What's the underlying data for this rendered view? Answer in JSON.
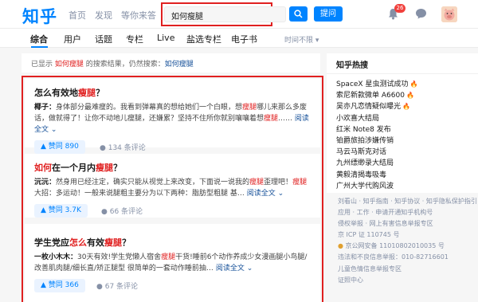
{
  "header": {
    "logo": "知乎",
    "nav": [
      "首页",
      "发现",
      "等你来答"
    ],
    "search_value": "如何瘦腿",
    "ask_label": "提问",
    "notification_count": "26"
  },
  "tabs": {
    "items": [
      "综合",
      "用户",
      "话题",
      "专栏",
      "Live",
      "盐选专栏",
      "电子书"
    ],
    "time_filter": "时间不限"
  },
  "notice": {
    "prefix": "已显示 ",
    "keyword": "如何瘦腿",
    "middle": " 的搜索结果，仍然搜索：",
    "link": "如何瘦腿"
  },
  "results": [
    {
      "title_pre": "怎么有效地",
      "title_kw": "瘦腿",
      "title_post": "？",
      "author": "椰子：",
      "excerpt_a": "身体部分最难瘦的。我看到弹幕真的想给她们一个白眼，想",
      "excerpt_kw": "瘦腿",
      "excerpt_b": "哪儿来那么多废话，做就得了！让你不动地儿瘦腿，还嫌累？坚持不住所你就别嚷嚷着想",
      "excerpt_kw2": "瘦腿",
      "excerpt_c": "……",
      "more": "阅读全文",
      "votes": "赞同 890",
      "comments": "134 条评论"
    },
    {
      "title_pre": "",
      "title_kw": "如何",
      "title_post": "在一个月内",
      "title_kw2": "瘦腿",
      "title_end": "？",
      "author": "沅沅：",
      "excerpt_a": "然身用已经注定，确实只能从视觉上来改变，下面说一说我的",
      "excerpt_kw": "瘦腿",
      "excerpt_b": "歪理吧！",
      "excerpt_kw2": "瘦腿",
      "excerpt_c": "大招：多运动！一般来说腿粗主要分为以下两种：脂肪型粗腿 基…",
      "more": "阅读全文",
      "votes": "赞同 3.7K",
      "comments": "66 条评论"
    },
    {
      "title_pre": "学生党应",
      "title_kw": "怎么",
      "title_post": "有效",
      "title_kw2": "瘦腿",
      "title_end": "？",
      "author": "一枚小木木：",
      "excerpt_a": "30天有效!学生党懒人宿舍",
      "excerpt_kw": "瘦腿",
      "excerpt_b": "干货!睡前6个动作养成少女漫画腿小鸟腿/改善肌肉腿/细长直/矫正腿型 很简单的一套动作睡前抽…",
      "more": "阅读全文",
      "votes": "赞同 366",
      "comments": "67 条评论"
    }
  ],
  "sidebar": {
    "title": "知乎热搜",
    "hot": [
      {
        "text": "SpaceX 星虫测试成功",
        "fire": true
      },
      {
        "text": "索尼新款微单 A6600",
        "fire": true
      },
      {
        "text": "吴亦凡恋情疑似曝光",
        "fire": true
      },
      {
        "text": "小欢喜大结局",
        "fire": false
      },
      {
        "text": "红米 Note8 发布",
        "fire": false
      },
      {
        "text": "铂爵旅拍涉嫌传销",
        "fire": false
      },
      {
        "text": "马云马斯克对话",
        "fire": false
      },
      {
        "text": "九州缥缈录大结局",
        "fire": false
      },
      {
        "text": "黄毅清揭毒吸毒",
        "fire": false
      },
      {
        "text": "广州大学代购风波",
        "fire": false
      }
    ]
  },
  "footer": [
    "刘看山 · 知乎指南 · 知乎协议 · 知乎隐私保护指引",
    "应用 · 工作 · 申请开通知乎机构号",
    "侵权举报 · 网上有害信息举报专区",
    "京 ICP 证 110745 号",
    "京公网安备 11010802010035 号",
    "违法和不良信息举报：010-82716601",
    "儿童色情信息举报专区",
    "证照中心"
  ],
  "colors": {
    "brand": "#0084ff",
    "highlight": "#e02020"
  }
}
